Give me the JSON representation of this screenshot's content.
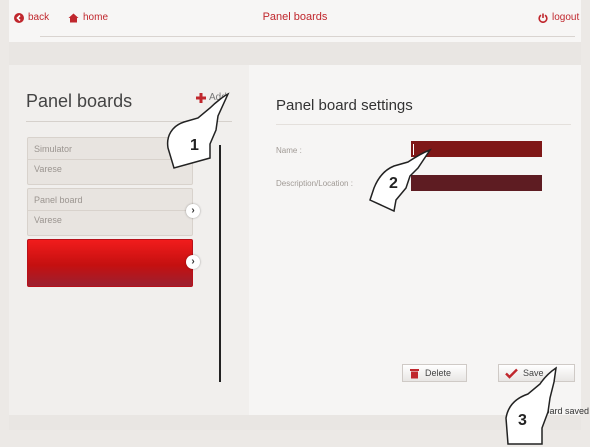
{
  "header": {
    "back_label": "back",
    "home_label": "home",
    "title": "Panel boards",
    "logout_label": "logout"
  },
  "left": {
    "title": "Panel boards",
    "add_label": "Add",
    "items": [
      {
        "line1": "Simulator",
        "line2": "Varese"
      },
      {
        "line1": "Panel board",
        "line2": "Varese"
      },
      {
        "line1": "",
        "line2": ""
      }
    ]
  },
  "settings": {
    "title": "Panel board settings",
    "name_label": "Name :",
    "name_value": "",
    "description_label": "Description/Location :",
    "description_value": ""
  },
  "actions": {
    "delete_label": "Delete",
    "save_label": "Save"
  },
  "status": {
    "message": "Panel board saved"
  },
  "callouts": [
    "1",
    "2",
    "3"
  ],
  "colors": {
    "accent": "#c0272d",
    "active_item": "#e31414",
    "field_name": "#7f1717",
    "field_description": "#5e1c22"
  }
}
